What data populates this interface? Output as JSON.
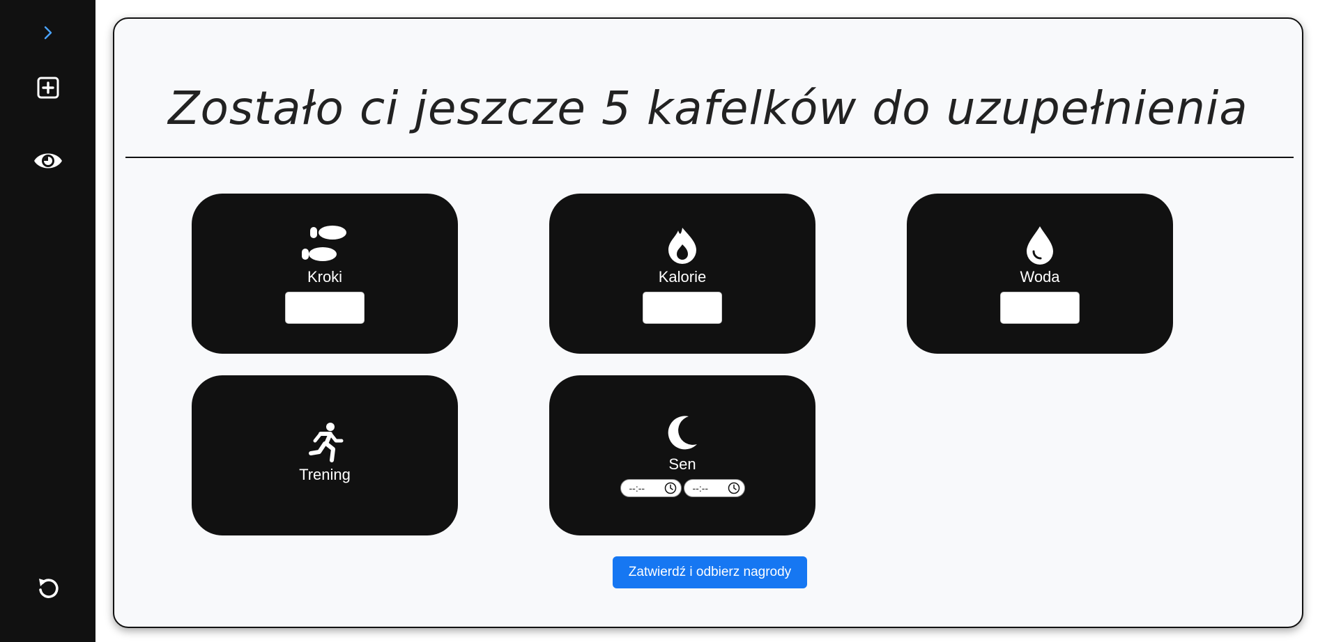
{
  "sidebar": {
    "expand_icon": "chevron-right-icon",
    "add_icon": "plus-square-icon",
    "view_icon": "eye-icon",
    "reset_icon": "rotate-ccw-icon",
    "accent": "#4aa3ff"
  },
  "header": {
    "title": "Zostało ci jeszcze 5 kafelków do uzupełnienia"
  },
  "tiles": [
    {
      "label": "Kroki",
      "icon": "footprints-icon",
      "input_value": ""
    },
    {
      "label": "Kalorie",
      "icon": "flame-icon",
      "input_value": ""
    },
    {
      "label": "Woda",
      "icon": "water-drop-icon",
      "input_value": ""
    },
    {
      "label": "Trening",
      "icon": "running-person-icon"
    },
    {
      "label": "Sen",
      "icon": "moon-icon",
      "time_from": "--:--",
      "time_to": "--:--"
    }
  ],
  "actions": {
    "submit_label": "Zatwierdź i odbierz nagrody",
    "submit_color": "#1677f2"
  }
}
